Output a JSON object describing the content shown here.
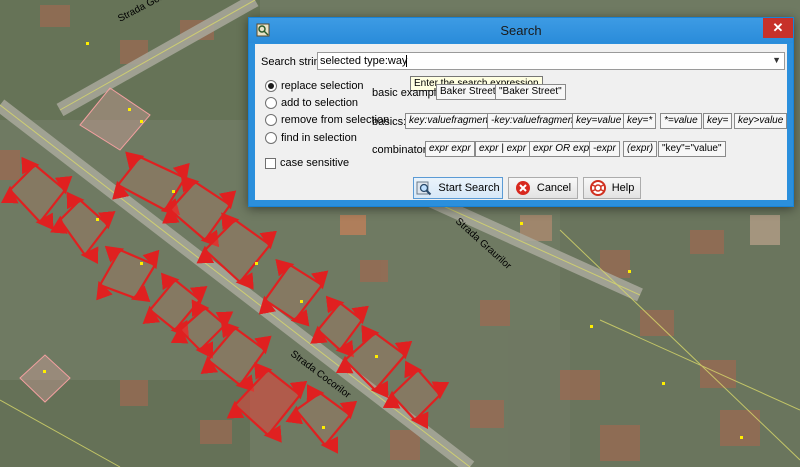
{
  "map": {
    "street_labels": [
      "Strada Gorunului",
      "Strada Graurilor",
      "Strada Cocorilor"
    ]
  },
  "dialog": {
    "title": "Search",
    "close_glyph": "✕",
    "search_label": "Search string:",
    "search_value": "selected type:way",
    "tooltip": "Enter the search expression",
    "modes": [
      {
        "label": "replace selection",
        "checked": true
      },
      {
        "label": "add to selection",
        "checked": false
      },
      {
        "label": "remove from selection",
        "checked": false
      },
      {
        "label": "find in selection",
        "checked": false
      }
    ],
    "case_sensitive_label": "case sensitive",
    "basic_examples_label": "basic examples:",
    "basic_examples": [
      "Baker Street",
      "\"Baker Street\""
    ],
    "basics_label": "basics:",
    "basics": [
      "key:valuefragment",
      "-key:valuefragment",
      "key=value",
      "key=*",
      "*=value",
      "key=",
      "key>value"
    ],
    "combinators_label": "combinators:",
    "combinators": [
      "expr expr",
      "expr | expr",
      "expr OR expr",
      "-expr",
      "(expr)",
      "\"key\"=\"value\""
    ],
    "buttons": {
      "start": "Start Search",
      "cancel": "Cancel",
      "help": "Help"
    }
  },
  "colors": {
    "accent": "#2b8fdc",
    "close": "#c7312a",
    "way": "#e02020",
    "node": "#ffee00"
  },
  "icons": {
    "app": "josm-icon",
    "start": "search-icon",
    "cancel": "cancel-icon",
    "help": "help-icon"
  }
}
